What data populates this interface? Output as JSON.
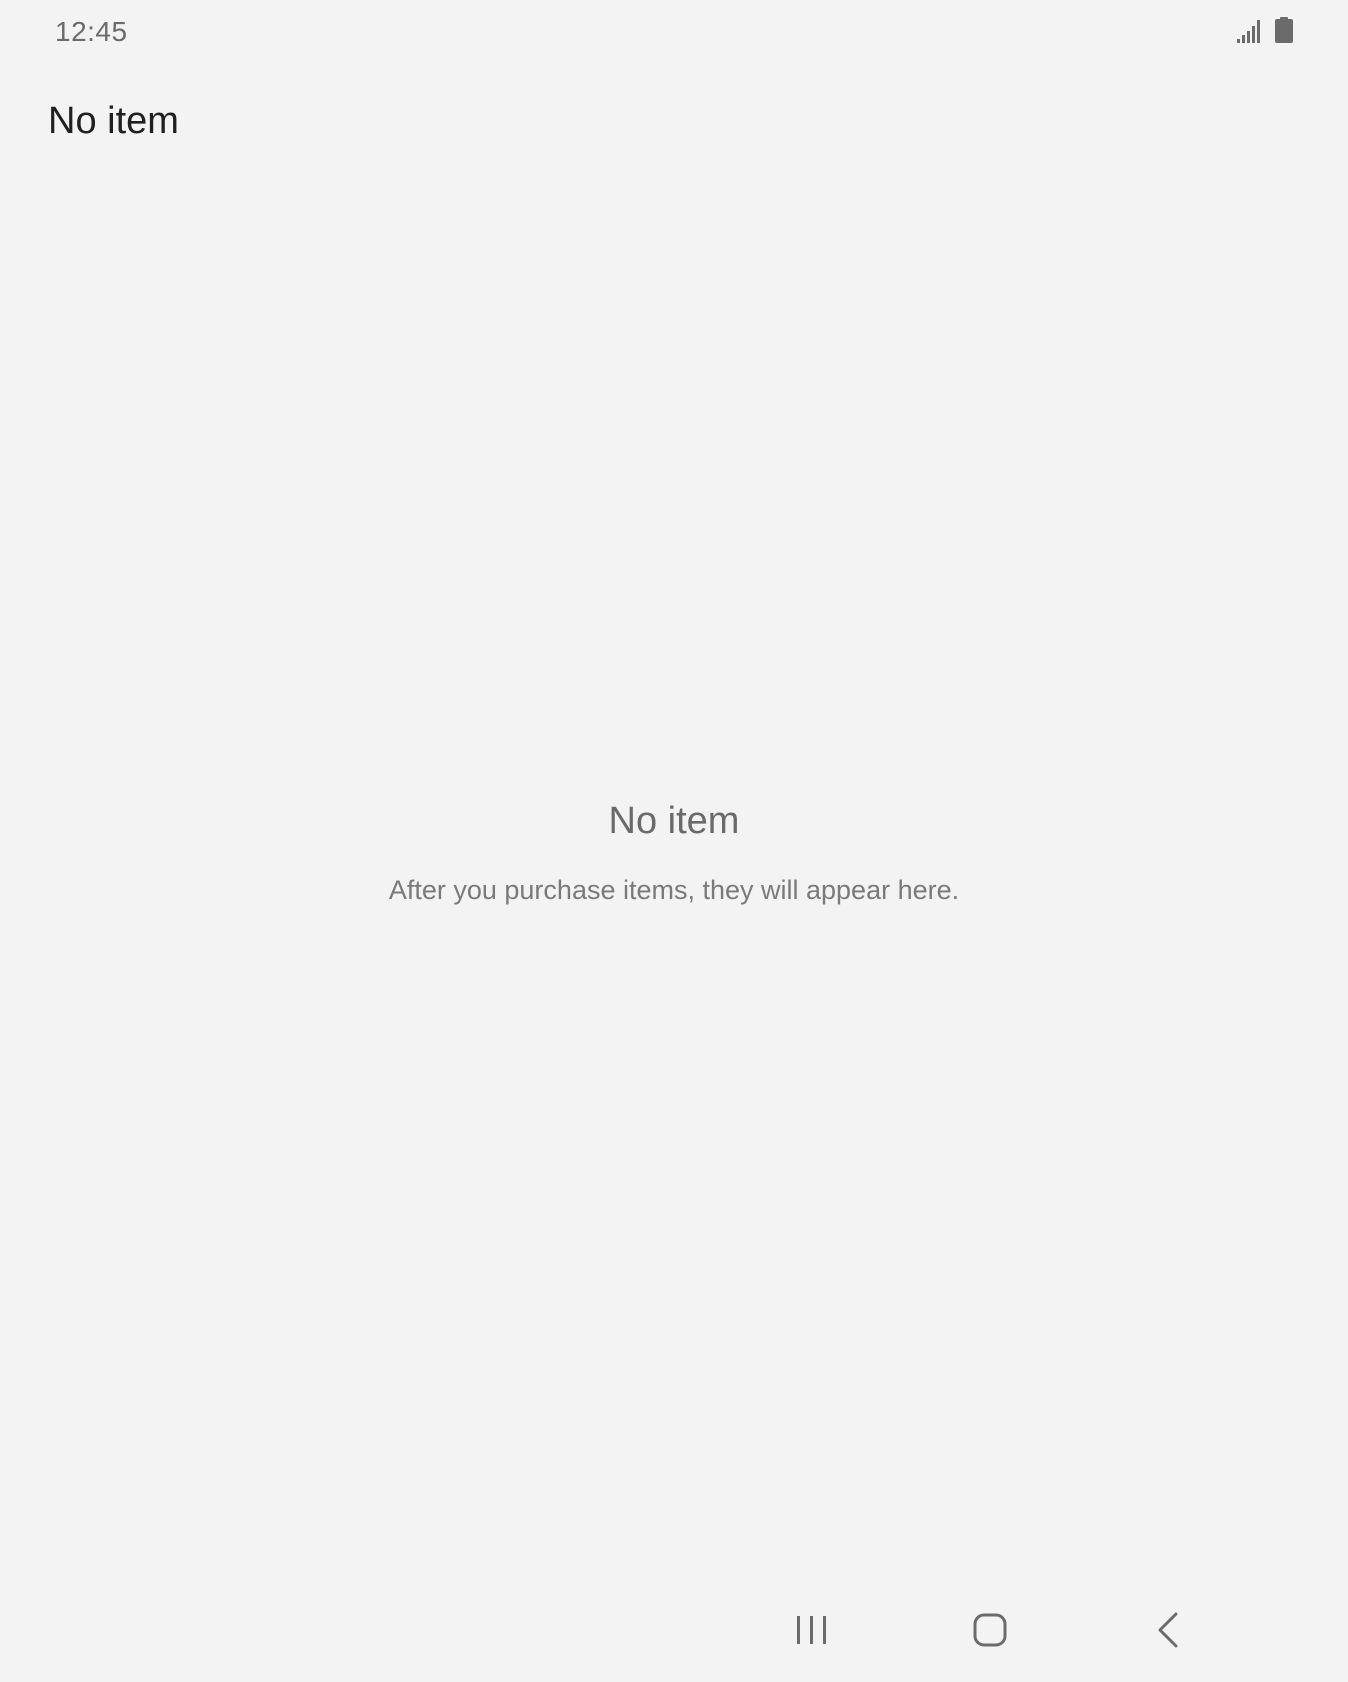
{
  "status_bar": {
    "time": "12:45",
    "icons": [
      "signal-icon",
      "battery-icon"
    ]
  },
  "header": {
    "title": "No item"
  },
  "empty_state": {
    "title": "No item",
    "message": "After you purchase items, they will appear here."
  },
  "nav_bar": {
    "buttons": [
      "recents-icon",
      "home-icon",
      "back-icon"
    ]
  },
  "colors": {
    "background": "#f3f3f3",
    "title_text": "#202020",
    "secondary_text": "#6a6a6a",
    "icon": "#6b6b6b"
  }
}
